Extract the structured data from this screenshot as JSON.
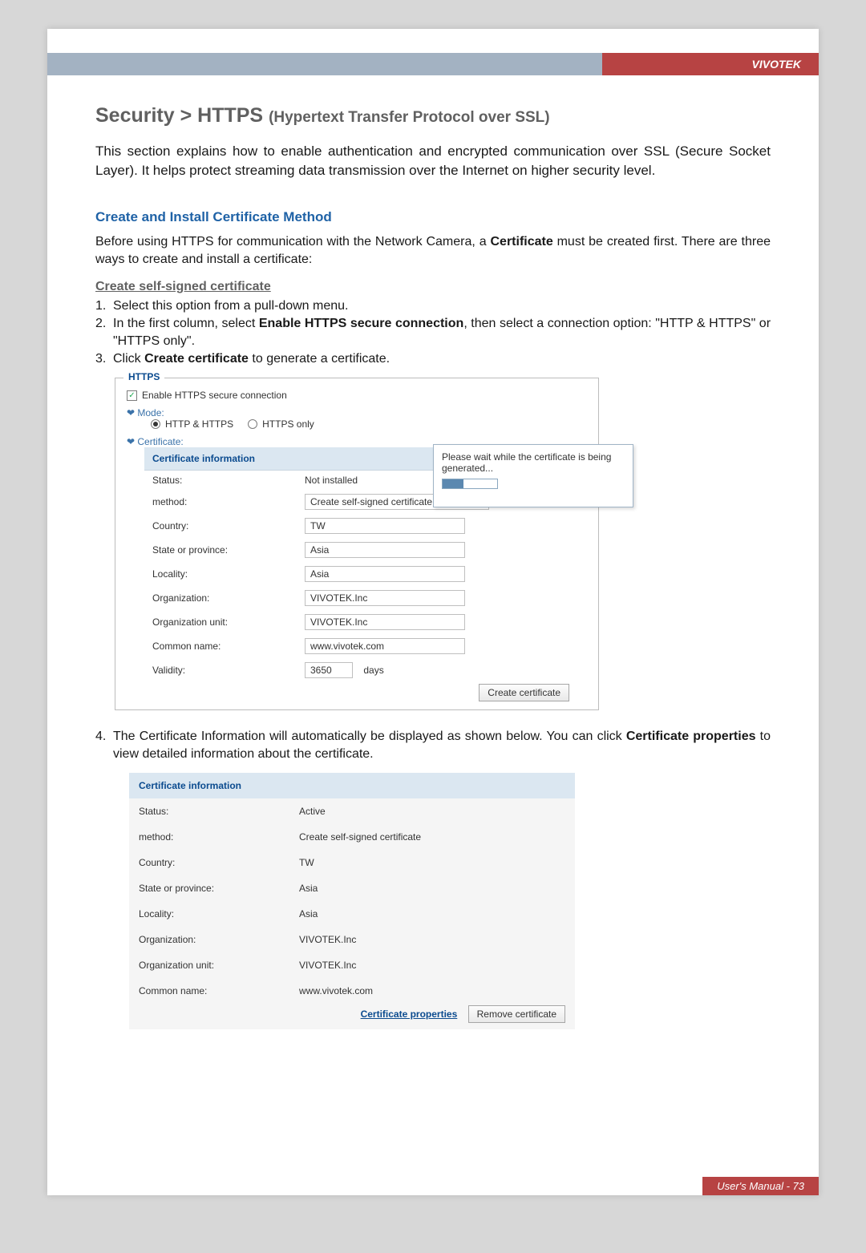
{
  "brand": "VIVOTEK",
  "footer": "User's Manual - 73",
  "title": {
    "main": "Security >  HTTPS",
    "sub": "(Hypertext Transfer Protocol over SSL)"
  },
  "intro": "This section explains how to enable authentication and encrypted communication over SSL (Secure Socket Layer). It helps protect streaming data transmission over the Internet on higher security level.",
  "section_h": "Create and Install Certificate Method",
  "para1_a": "Before using HTTPS for communication with the Network Camera, a ",
  "para1_b": "Certificate",
  "para1_c": " must be created first. There are three ways to create and install a certificate:",
  "sub_h": "Create self-signed certificate",
  "steps": {
    "s1": "Select this option from a pull-down menu.",
    "s2a": "In the first column, select ",
    "s2b": "Enable HTTPS secure connection",
    "s2c": ", then select a connection option: \"HTTP & HTTPS\" or \"HTTPS only\".",
    "s3a": "Click ",
    "s3b": "Create certificate",
    "s3c": " to generate a certificate."
  },
  "shot1": {
    "legend": "HTTPS",
    "enable_label": "Enable HTTPS secure connection",
    "mode_label": "Mode:",
    "mode_opt1": "HTTP & HTTPS",
    "mode_opt2": "HTTPS only",
    "cert_label": "Certificate:",
    "cert_head": "Certificate information",
    "rows": {
      "status_l": "Status:",
      "status_v": "Not installed",
      "method_l": "method:",
      "method_v": "Create self-signed certificate",
      "country_l": "Country:",
      "country_v": "TW",
      "state_l": "State or province:",
      "state_v": "Asia",
      "locality_l": "Locality:",
      "locality_v": "Asia",
      "org_l": "Organization:",
      "org_v": "VIVOTEK.Inc",
      "orgu_l": "Organization unit:",
      "orgu_v": "VIVOTEK.Inc",
      "cn_l": "Common name:",
      "cn_v": "www.vivotek.com",
      "valid_l": "Validity:",
      "valid_v": "3650",
      "valid_unit": "days"
    },
    "tooltip": "Please wait while the certificate is being generated...",
    "button": "Create certificate"
  },
  "para2_a": "The Certificate Information will automatically be displayed as shown below. You can click ",
  "para2_b": "Certificate properties",
  "para2_c": " to view detailed information about the certificate.",
  "step4_num": "4.",
  "shot2": {
    "head": "Certificate information",
    "rows": {
      "status_l": "Status:",
      "status_v": "Active",
      "method_l": "method:",
      "method_v": "Create self-signed certificate",
      "country_l": "Country:",
      "country_v": "TW",
      "state_l": "State or province:",
      "state_v": "Asia",
      "locality_l": "Locality:",
      "locality_v": "Asia",
      "org_l": "Organization:",
      "org_v": "VIVOTEK.Inc",
      "orgu_l": "Organization unit:",
      "orgu_v": "VIVOTEK.Inc",
      "cn_l": "Common name:",
      "cn_v": "www.vivotek.com"
    },
    "link": "Certificate properties",
    "button": "Remove certificate"
  }
}
